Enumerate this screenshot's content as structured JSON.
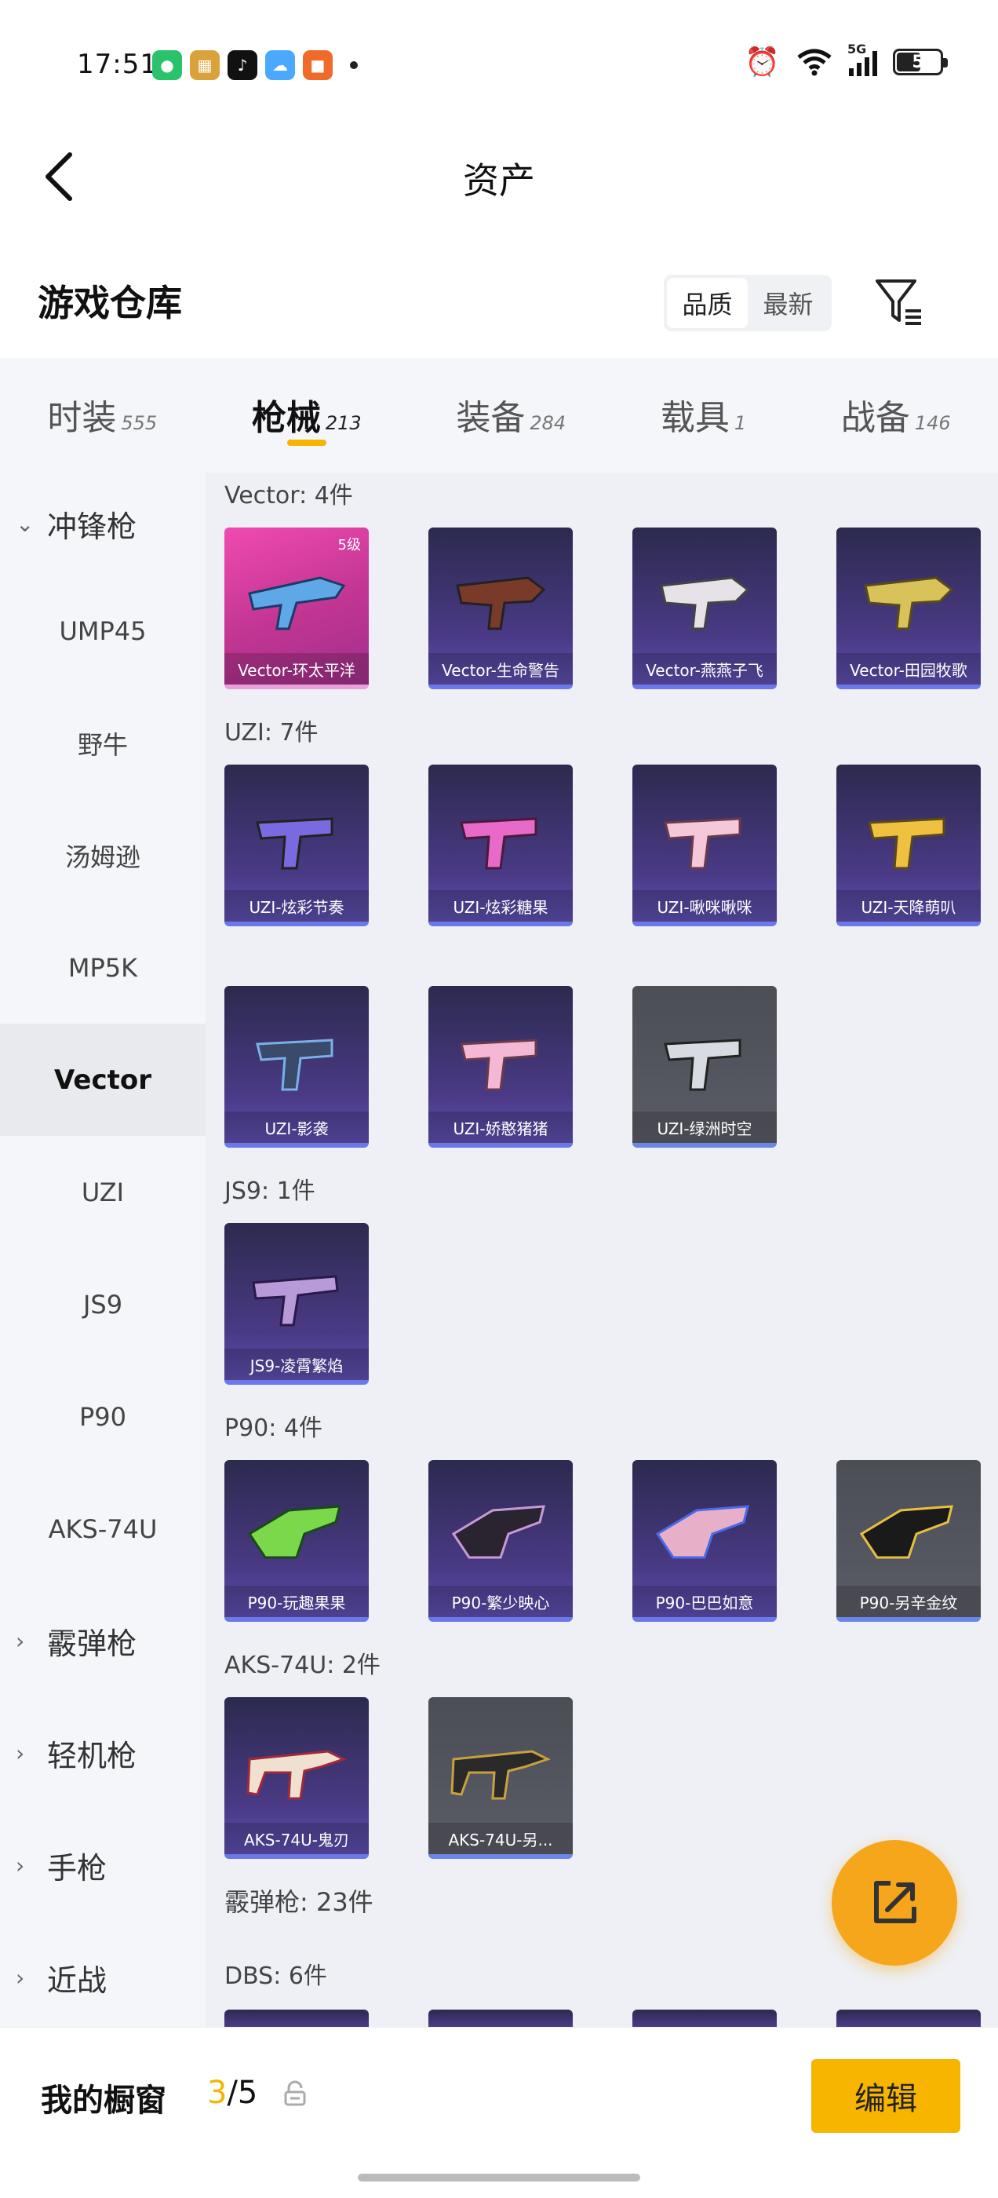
{
  "status_bar": {
    "time": "17:51",
    "network": "5G",
    "battery": "5"
  },
  "header": {
    "title": "资产"
  },
  "warehouse": {
    "title": "游戏仓库",
    "sort_options": [
      "品质",
      "最新"
    ],
    "active_sort": "品质"
  },
  "tabs": [
    {
      "label": "时装",
      "count": "555"
    },
    {
      "label": "枪械",
      "count": "213"
    },
    {
      "label": "装备",
      "count": "284"
    },
    {
      "label": "载具",
      "count": "1"
    },
    {
      "label": "战备",
      "count": "146"
    }
  ],
  "sidebar": {
    "groups": [
      {
        "label": "冲锋枪",
        "expanded": true
      },
      {
        "label": "霰弹枪"
      },
      {
        "label": "轻机枪"
      },
      {
        "label": "手枪"
      },
      {
        "label": "近战"
      }
    ],
    "smg_items": [
      "UMP45",
      "野牛",
      "汤姆逊",
      "MP5K",
      "Vector",
      "UZI",
      "JS9",
      "P90",
      "AKS-74U"
    ],
    "active": "Vector"
  },
  "sections": [
    {
      "label": "Vector: 4件",
      "cards": [
        {
          "name": "Vector-环太平洋",
          "badge": "5级"
        },
        {
          "name": "Vector-生命警告"
        },
        {
          "name": "Vector-燕燕子飞"
        },
        {
          "name": "Vector-田园牧歌"
        }
      ]
    },
    {
      "label": "UZI: 7件",
      "cards": [
        {
          "name": "UZI-炫彩节奏"
        },
        {
          "name": "UZI-炫彩糖果"
        },
        {
          "name": "UZI-啾咪啾咪"
        },
        {
          "name": "UZI-天降萌叭"
        },
        {
          "name": "UZI-影袭"
        },
        {
          "name": "UZI-娇憨猪猪"
        },
        {
          "name": "UZI-绿洲时空"
        }
      ]
    },
    {
      "label": "JS9: 1件",
      "cards": [
        {
          "name": "JS9-凌霄繁焰"
        }
      ]
    },
    {
      "label": "P90: 4件",
      "cards": [
        {
          "name": "P90-玩趣果果"
        },
        {
          "name": "P90-繁少映心"
        },
        {
          "name": "P90-巴巴如意"
        },
        {
          "name": "P90-另辛金纹"
        }
      ]
    },
    {
      "label": "AKS-74U: 2件",
      "cards": [
        {
          "name": "AKS-74U-鬼刃"
        },
        {
          "name": "AKS-74U-另..."
        }
      ]
    }
  ],
  "shotgun_section": {
    "label": "霰弹枪: 23件"
  },
  "dbs_section": {
    "label": "DBS: 6件"
  },
  "bottom_bar": {
    "showcase_label": "我的橱窗",
    "showcase_current": "3",
    "showcase_total": "/5",
    "edit_label": "编辑"
  }
}
